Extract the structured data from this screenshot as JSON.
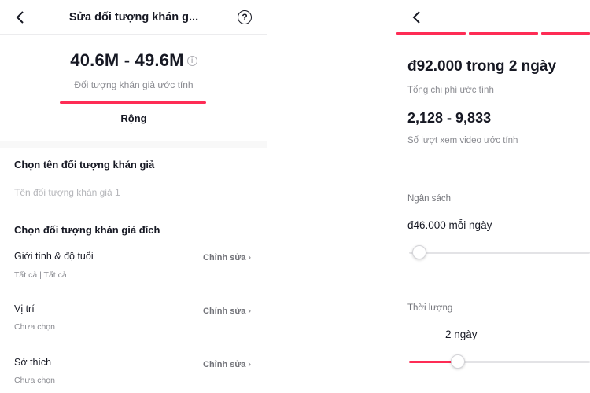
{
  "left": {
    "header": {
      "title": "Sửa đối tượng khán g...",
      "help_glyph": "?"
    },
    "estimate": {
      "range": "40.6M - 49.6M",
      "info_glyph": "i",
      "caption": "Đối tượng khán giả ước tính",
      "breadth": "Rộng"
    },
    "name_section": {
      "heading": "Chọn tên đối tượng khán giả",
      "placeholder": "Tên đối tượng khán giả 1"
    },
    "target_section": {
      "heading": "Chọn đối tượng khán giả đích",
      "rows": [
        {
          "title": "Giới tính & độ tuổi",
          "value": "Tất cả | Tất cả",
          "edit": "Chỉnh sửa"
        },
        {
          "title": "Vị trí",
          "value": "Chưa chọn",
          "edit": "Chỉnh sửa"
        },
        {
          "title": "Sở thích",
          "value": "Chưa chọn",
          "edit": "Chỉnh sửa"
        }
      ]
    }
  },
  "right": {
    "total_cost": "đ92.000 trong 2 ngày",
    "total_caption": "Tổng chi phí ước tính",
    "views": "2,128 - 9,833",
    "views_caption": "Số lượt xem video ước tính",
    "budget": {
      "label": "Ngân sách",
      "value": "đ46.000 mỗi ngày",
      "level": 0.02
    },
    "duration": {
      "label": "Thời lượng",
      "value": "2 ngày",
      "level": 0.25
    }
  },
  "colors": {
    "accent": "#fe2c55",
    "text": "#161823",
    "muted": "#8a8b91"
  },
  "icons": {
    "back": "back-chevron-icon",
    "help": "help-circle-icon",
    "info": "info-circle-icon",
    "edit": "chevron-right-icon"
  }
}
